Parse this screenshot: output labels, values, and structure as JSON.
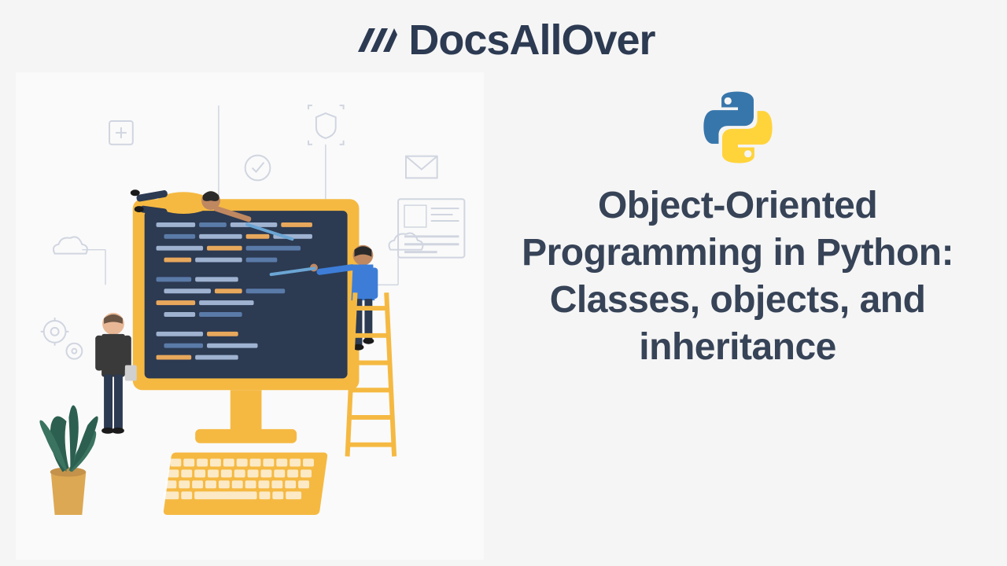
{
  "brand": {
    "name": "DocsAllOver"
  },
  "article": {
    "title": "Object-Oriented Programming in Python: Classes, objects, and inheritance"
  },
  "colors": {
    "text": "#374357",
    "monitor_frame": "#f5b942",
    "screen": "#2c3a52",
    "python_blue": "#3776ab",
    "python_yellow": "#ffd43b",
    "plant_green": "#2c5f4f",
    "pot": "#dda853"
  }
}
